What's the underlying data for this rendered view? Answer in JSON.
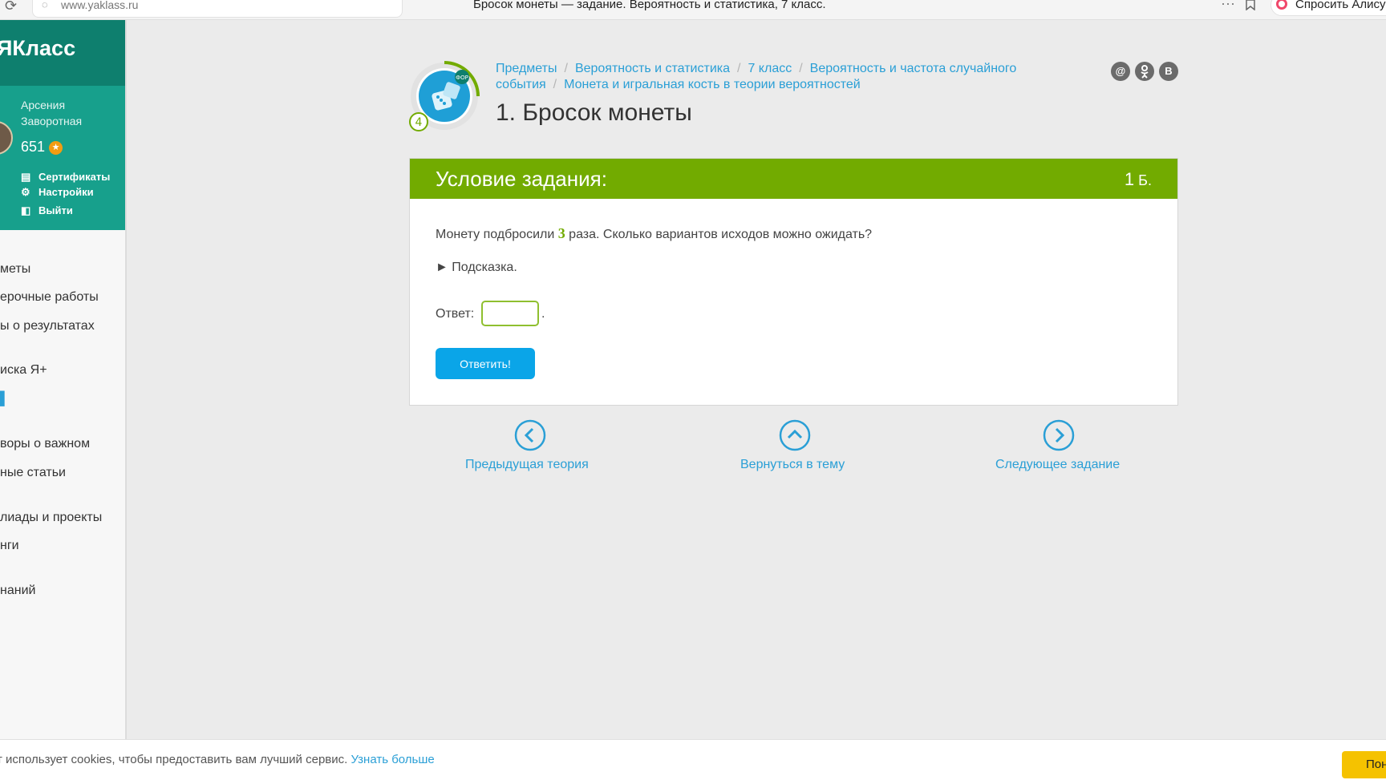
{
  "browser": {
    "url": "www.yaklass.ru",
    "tab_title": "Бросок монеты — задание. Вероятность и статистика, 7 класс.",
    "more": "···",
    "alice_label": "Спросить Алису"
  },
  "sidebar": {
    "logo": "ЯКласс",
    "user_name": "Арсения Заворотная",
    "points": "651",
    "links": [
      {
        "label": "Сертификаты"
      },
      {
        "label": "Настройки"
      },
      {
        "label": "Выйти"
      }
    ],
    "nav": [
      {
        "label": "меты"
      },
      {
        "label": "ерочные работы"
      },
      {
        "label": "ы о результатах"
      },
      {
        "label": "иска Я+"
      },
      {
        "label": ""
      },
      {
        "label": "воры о важном"
      },
      {
        "label": "ные статьи"
      },
      {
        "label": "лиады и проекты"
      },
      {
        "label": "нги"
      },
      {
        "label": "наний"
      }
    ]
  },
  "breadcrumbs": [
    "Предметы",
    "Вероятность и статистика",
    "7 класс",
    "Вероятность и частота случайного события",
    "Монета и игральная кость в теории вероятностей"
  ],
  "badge": {
    "level": "4",
    "tag": "ФОР"
  },
  "social": [
    "@",
    "ok",
    "B"
  ],
  "page_title": "1. Бросок монеты",
  "task": {
    "header": "Условие задания:",
    "points": "1",
    "points_unit": "Б.",
    "question_before": "Монету подбросили ",
    "question_number": "3",
    "question_after": " раза. Сколько вариантов исходов можно ожидать?",
    "hint": "► Подсказка.",
    "answer_label": "Ответ:",
    "answer_value": "",
    "answer_suffix": ".",
    "submit_label": "Ответить!"
  },
  "bottom_nav": {
    "prev": "Предыдущая теория",
    "back": "Вернуться в тему",
    "next": "Следующее задание"
  },
  "cookie": {
    "text": "т использует cookies, чтобы предоставить вам лучший сервис.",
    "link": "Узнать больше",
    "button": "Понятно"
  },
  "colors": {
    "sidebar_header": "#0e7f6e",
    "sidebar_profile": "#17a08c",
    "task_header": "#72ab00",
    "link": "#2a9fd6",
    "submit": "#0aa5e8",
    "cookie_button": "#f5c200"
  }
}
